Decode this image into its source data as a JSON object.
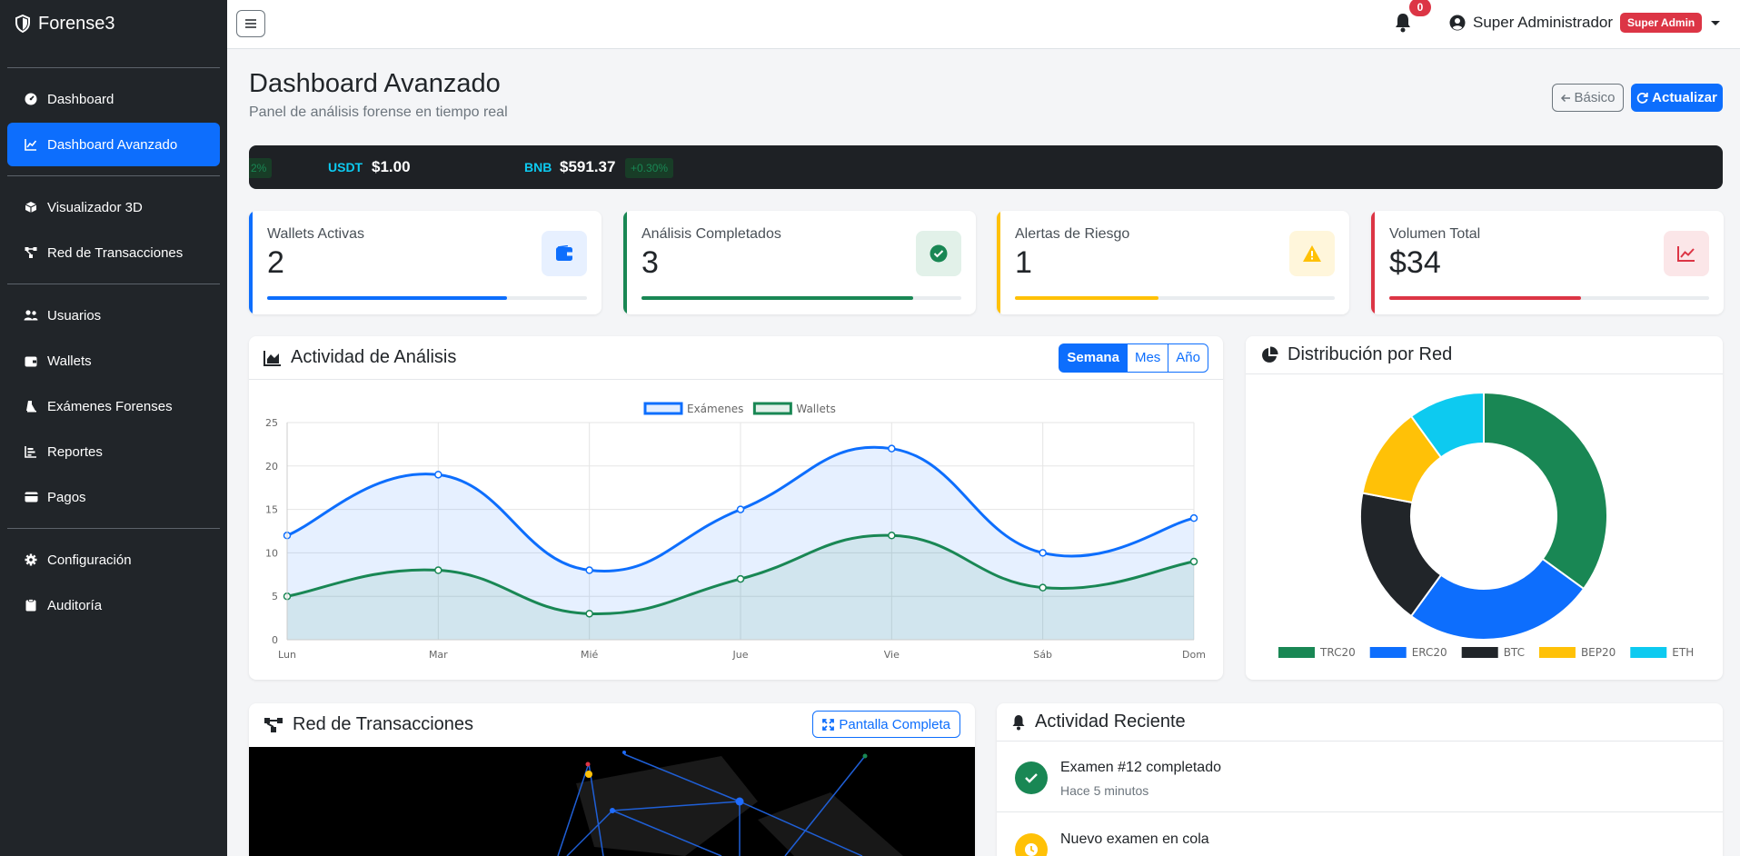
{
  "app": {
    "brand": "Forense3"
  },
  "sidebar": {
    "items": [
      {
        "label": "Dashboard",
        "icon": "gauge-icon",
        "active": false
      },
      {
        "label": "Dashboard Avanzado",
        "icon": "chart-line-icon",
        "active": true
      },
      {
        "label": "Visualizador 3D",
        "icon": "cube-icon",
        "active": false
      },
      {
        "label": "Red de Transacciones",
        "icon": "network-icon",
        "active": false
      },
      {
        "label": "Usuarios",
        "icon": "users-icon",
        "active": false
      },
      {
        "label": "Wallets",
        "icon": "wallet-icon",
        "active": false
      },
      {
        "label": "Exámenes Forenses",
        "icon": "flask-icon",
        "active": false
      },
      {
        "label": "Reportes",
        "icon": "bar-chart-icon",
        "active": false
      },
      {
        "label": "Pagos",
        "icon": "credit-card-icon",
        "active": false
      },
      {
        "label": "Configuración",
        "icon": "gear-icon",
        "active": false
      },
      {
        "label": "Auditoría",
        "icon": "clipboard-icon",
        "active": false
      }
    ]
  },
  "topbar": {
    "notifications": "0",
    "user_name": "Super Administrador",
    "role": "Super Admin"
  },
  "header": {
    "title": "Dashboard Avanzado",
    "subtitle": "Panel de análisis forense en tiempo real",
    "basic_label": "Básico",
    "update_label": "Actualizar"
  },
  "ticker": {
    "partial_change": "2%",
    "items": [
      {
        "symbol": "USDT",
        "price": "$1.00",
        "change": ""
      },
      {
        "symbol": "BNB",
        "price": "$591.37",
        "change": "+0.30%"
      }
    ]
  },
  "stats": [
    {
      "label": "Wallets Activas",
      "value": "2",
      "color": "#0d6efd",
      "bg": "#e7f0ff",
      "progress": 0.75,
      "icon": "wallet-icon"
    },
    {
      "label": "Análisis Completados",
      "value": "3",
      "color": "#198754",
      "bg": "#e2f1e9",
      "progress": 0.85,
      "icon": "check-circle-icon"
    },
    {
      "label": "Alertas de Riesgo",
      "value": "1",
      "color": "#ffc107",
      "bg": "#fff6db",
      "progress": 0.45,
      "icon": "warning-icon"
    },
    {
      "label": "Volumen Total",
      "value": "$34",
      "color": "#dc3545",
      "bg": "#fbe6e8",
      "progress": 0.6,
      "icon": "chart-line-icon"
    }
  ],
  "activity_chart": {
    "title": "Actividad de Análisis",
    "periods": [
      "Semana",
      "Mes",
      "Año"
    ]
  },
  "chart_data": [
    {
      "type": "line",
      "x": [
        "Lun",
        "Mar",
        "Mié",
        "Jue",
        "Vie",
        "Sáb",
        "Dom"
      ],
      "ylim": [
        0,
        25
      ],
      "yticks": [
        0,
        5,
        10,
        15,
        20,
        25
      ],
      "grid": true,
      "legend": "top",
      "series": [
        {
          "name": "Exámenes",
          "values": [
            12,
            19,
            8,
            15,
            22,
            10,
            14
          ],
          "color": "#0d6efd"
        },
        {
          "name": "Wallets",
          "values": [
            5,
            8,
            3,
            7,
            12,
            6,
            9
          ],
          "color": "#198754"
        }
      ]
    },
    {
      "type": "pie",
      "labels": [
        "TRC20",
        "ERC20",
        "BTC",
        "BEP20",
        "ETH"
      ],
      "values": [
        35,
        25,
        18,
        12,
        10
      ],
      "colors": [
        "#198754",
        "#0d6efd",
        "#212529",
        "#ffc107",
        "#0dcaf0"
      ],
      "legend": "bottom"
    }
  ],
  "distribution": {
    "title": "Distribución por Red"
  },
  "network": {
    "title": "Red de Transacciones",
    "fullscreen_label": "Pantalla Completa"
  },
  "recent": {
    "title": "Actividad Reciente",
    "items": [
      {
        "title": "Examen #12 completado",
        "time": "Hace 5 minutos",
        "color": "#198754",
        "icon": "check-icon"
      },
      {
        "title": "Nuevo examen en cola",
        "time": "",
        "color": "#ffc107",
        "icon": "clock-icon"
      }
    ]
  }
}
